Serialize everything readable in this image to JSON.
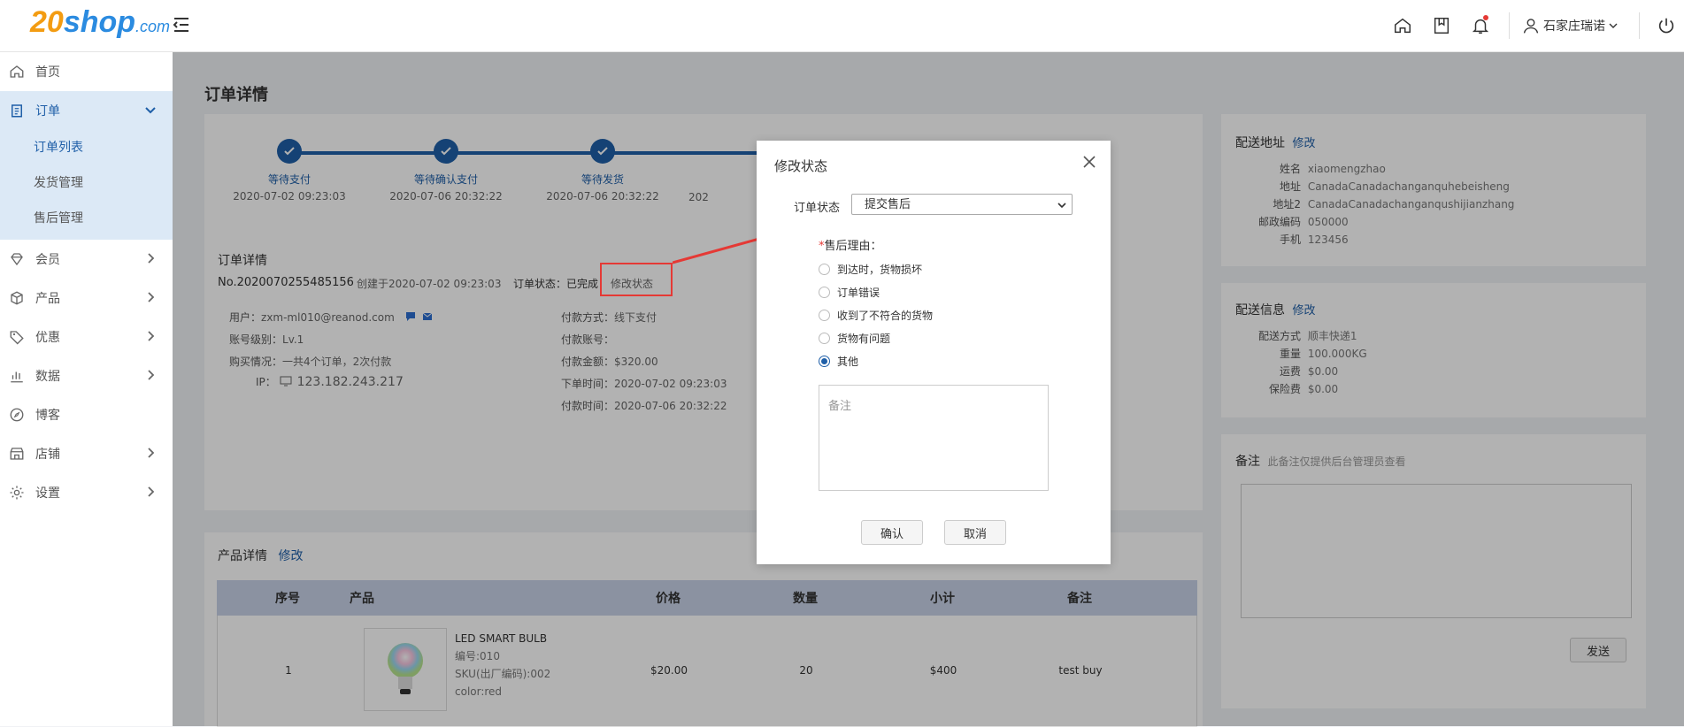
{
  "logo": {
    "num": "20",
    "shop": "shop",
    "com": ".com"
  },
  "header": {
    "user_name": "石家庄瑞诺",
    "icons": [
      "home-icon",
      "bookmark-icon",
      "bell-icon",
      "user-icon",
      "power-icon"
    ]
  },
  "sidebar": {
    "items": [
      {
        "label": "首页",
        "icon": "home-icon"
      },
      {
        "label": "订单",
        "icon": "clipboard-icon"
      },
      {
        "label": "会员",
        "icon": "diamond-icon"
      },
      {
        "label": "产品",
        "icon": "box-icon"
      },
      {
        "label": "优惠",
        "icon": "tag-icon"
      },
      {
        "label": "数据",
        "icon": "chart-icon"
      },
      {
        "label": "博客",
        "icon": "compass-icon"
      },
      {
        "label": "店铺",
        "icon": "store-icon"
      },
      {
        "label": "设置",
        "icon": "gear-icon"
      }
    ],
    "order_sub": [
      "订单列表",
      "发货管理",
      "售后管理"
    ]
  },
  "page": {
    "title": "订单详情"
  },
  "steps": [
    {
      "label": "等待支付",
      "time": "2020-07-02 09:23:03"
    },
    {
      "label": "等待确认支付",
      "time": "2020-07-06 20:32:22"
    },
    {
      "label": "等待发货",
      "time": "2020-07-06 20:32:22"
    },
    {
      "label": "",
      "time": "202"
    }
  ],
  "order": {
    "section_title": "订单详情",
    "number": "No.2020070255485156",
    "created": "创建于2020-07-02 09:23:03",
    "status": "订单状态：已完成",
    "change_status": "修改状态",
    "user_label": "用户：",
    "user_value": "zxm-ml010@reanod.com",
    "level_label": "账号级别：",
    "level_value": "Lv.1",
    "purchase_label": "购买情况：",
    "purchase_value": "一共4个订单，2次付款",
    "ip_label": "IP：",
    "ip_value": "123.182.243.217",
    "pay_method_label": "付款方式：",
    "pay_method_value": "线下支付",
    "pay_account_label": "付款账号：",
    "pay_amount_label": "付款金额：",
    "pay_amount_value": "$320.00",
    "order_time_label": "下单时间：",
    "order_time_value": "2020-07-02 09:23:03",
    "pay_time_label": "付款时间：",
    "pay_time_value": "2020-07-06 20:32:22"
  },
  "products": {
    "title": "产品详情",
    "edit": "修改",
    "headers": [
      "序号",
      "产品",
      "价格",
      "数量",
      "小计",
      "备注"
    ],
    "rows": [
      {
        "index": "1",
        "name": "LED SMART BULB",
        "code": "编号:010",
        "sku": "SKU(出厂编码):002",
        "color": "color:red",
        "price": "$20.00",
        "qty": "20",
        "subtotal": "$400",
        "note": "test buy"
      }
    ]
  },
  "shipping_address": {
    "title": "配送地址",
    "edit": "修改",
    "fields": [
      {
        "k": "姓名",
        "v": "xiaomengzhao"
      },
      {
        "k": "地址",
        "v": "CanadaCanadachanganquhebeisheng"
      },
      {
        "k": "地址2",
        "v": "CanadaCanadachanganqushijianzhang"
      },
      {
        "k": "邮政编码",
        "v": "050000"
      },
      {
        "k": "手机",
        "v": "123456"
      }
    ]
  },
  "shipping_info": {
    "title": "配送信息",
    "edit": "修改",
    "fields": [
      {
        "k": "配送方式",
        "v": "顺丰快递1"
      },
      {
        "k": "重量",
        "v": "100.000KG"
      },
      {
        "k": "运费",
        "v": "$0.00"
      },
      {
        "k": "保险费",
        "v": "$0.00"
      }
    ]
  },
  "remark": {
    "title": "备注",
    "hint": "此备注仅提供后台管理员查看",
    "send": "发送"
  },
  "modal": {
    "title": "修改状态",
    "status_label": "订单状态",
    "status_value": "提交售后",
    "reason_star": "*",
    "reason_label": "售后理由：",
    "reasons": [
      "到达时，货物损坏",
      "订单错误",
      "收到了不符合的货物",
      "货物有问题",
      "其他"
    ],
    "selected_reason": "其他",
    "note_placeholder": "备注",
    "confirm": "确认",
    "cancel": "取消"
  },
  "colors": {
    "accent": "#1f5fa8",
    "highlight": "#e53935",
    "logo_orange": "#f39c12",
    "logo_blue": "#2b8be0"
  }
}
